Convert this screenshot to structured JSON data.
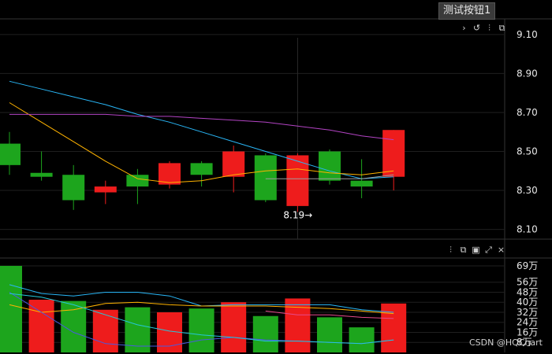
{
  "button": {
    "label": "测试按钮1"
  },
  "toolbar_main": {
    "icons": [
      "chevron-right-icon",
      "refresh-icon",
      "indicator-settings-icon",
      "copy-icon"
    ]
  },
  "toolbar_vol": {
    "icons": [
      "indicator-settings-icon",
      "copy-icon",
      "save-icon",
      "maximize-icon",
      "close-icon"
    ]
  },
  "watermark": "CSDN @HQChart",
  "colors": {
    "up": "#ee1c1c",
    "down": "#1da51d",
    "background": "#000000",
    "grid": "#1f1f1f",
    "axis_text": "#e6e6e6"
  },
  "chart_data": [
    {
      "type": "candlestick",
      "name": "price",
      "ylim": [
        8.05,
        9.18
      ],
      "yticks": [
        9.1,
        8.9,
        8.7,
        8.5,
        8.3,
        8.1
      ],
      "ytick_labels": [
        "9.10",
        "8.90",
        "8.70",
        "8.50",
        "8.30",
        "8.10"
      ],
      "candles": [
        {
          "open": 8.54,
          "close": 8.43,
          "high": 8.6,
          "low": 8.38
        },
        {
          "open": 8.39,
          "close": 8.37,
          "high": 8.5,
          "low": 8.35
        },
        {
          "open": 8.38,
          "close": 8.25,
          "high": 8.43,
          "low": 8.2
        },
        {
          "open": 8.29,
          "close": 8.32,
          "high": 8.35,
          "low": 8.23
        },
        {
          "open": 8.38,
          "close": 8.32,
          "high": 8.41,
          "low": 8.23
        },
        {
          "open": 8.33,
          "close": 8.44,
          "high": 8.45,
          "low": 8.31
        },
        {
          "open": 8.44,
          "close": 8.38,
          "high": 8.45,
          "low": 8.32
        },
        {
          "open": 8.37,
          "close": 8.5,
          "high": 8.53,
          "low": 8.29
        },
        {
          "open": 8.48,
          "close": 8.25,
          "high": 8.49,
          "low": 8.24
        },
        {
          "open": 8.22,
          "close": 8.48,
          "high": 8.49,
          "low": 8.19
        },
        {
          "open": 8.5,
          "close": 8.35,
          "high": 8.51,
          "low": 8.33
        },
        {
          "open": 8.35,
          "close": 8.32,
          "high": 8.46,
          "low": 8.26
        },
        {
          "open": 8.37,
          "close": 8.61,
          "high": 8.61,
          "low": 8.3
        }
      ],
      "ma_lines": [
        {
          "color": "#29b6f6",
          "values": [
            8.86,
            8.82,
            8.78,
            8.74,
            8.69,
            8.65,
            8.6,
            8.55,
            8.5,
            8.45,
            8.4,
            8.36,
            8.37
          ]
        },
        {
          "color": "#ffb300",
          "values": [
            8.75,
            8.65,
            8.55,
            8.45,
            8.36,
            8.34,
            8.35,
            8.38,
            8.4,
            8.41,
            8.39,
            8.38,
            8.4
          ]
        },
        {
          "color": "#b344c4",
          "values": [
            8.69,
            8.69,
            8.69,
            8.69,
            8.68,
            8.68,
            8.67,
            8.66,
            8.65,
            8.63,
            8.61,
            8.58,
            8.56
          ]
        },
        {
          "color": "#9e9e9e",
          "values": [
            null,
            null,
            null,
            null,
            null,
            null,
            null,
            null,
            8.36,
            8.36,
            8.36,
            8.36,
            8.38
          ]
        }
      ],
      "annotations": [
        {
          "text": "8.19→",
          "index": 9,
          "value": 8.19
        }
      ]
    },
    {
      "type": "bar",
      "name": "volume",
      "ylim": [
        0,
        74
      ],
      "yticks": [
        69,
        56,
        48,
        40,
        32,
        24,
        16,
        8
      ],
      "ytick_labels": [
        "69万",
        "56万",
        "48万",
        "40万",
        "32万",
        "24万",
        "16万",
        "8万"
      ],
      "values": [
        69,
        42,
        41,
        34,
        36,
        32,
        35,
        40,
        29,
        43,
        28,
        20,
        39
      ],
      "directions": [
        "down",
        "up",
        "down",
        "up",
        "down",
        "up",
        "down",
        "up",
        "down",
        "up",
        "down",
        "down",
        "up"
      ],
      "ma_lines": [
        {
          "color": "#29b6f6",
          "values": [
            54,
            47,
            45,
            48,
            48,
            45,
            37,
            38,
            38,
            38,
            38,
            34,
            32
          ]
        },
        {
          "color": "#ffb300",
          "values": [
            38,
            32,
            34,
            39,
            40,
            38,
            37,
            37,
            37,
            36,
            35,
            33,
            31
          ]
        },
        {
          "color": "#4a5ae0",
          "values": [
            48,
            32,
            16,
            7,
            5,
            5,
            10,
            12,
            10,
            9,
            8,
            7,
            10
          ]
        },
        {
          "color": "#26c6da",
          "values": [
            47,
            44,
            38,
            30,
            22,
            17,
            14,
            12,
            9,
            9,
            8,
            7,
            10
          ]
        },
        {
          "color": "#e64a8c",
          "values": [
            null,
            null,
            null,
            null,
            null,
            null,
            null,
            null,
            33,
            30,
            30,
            28,
            27
          ]
        }
      ]
    }
  ]
}
